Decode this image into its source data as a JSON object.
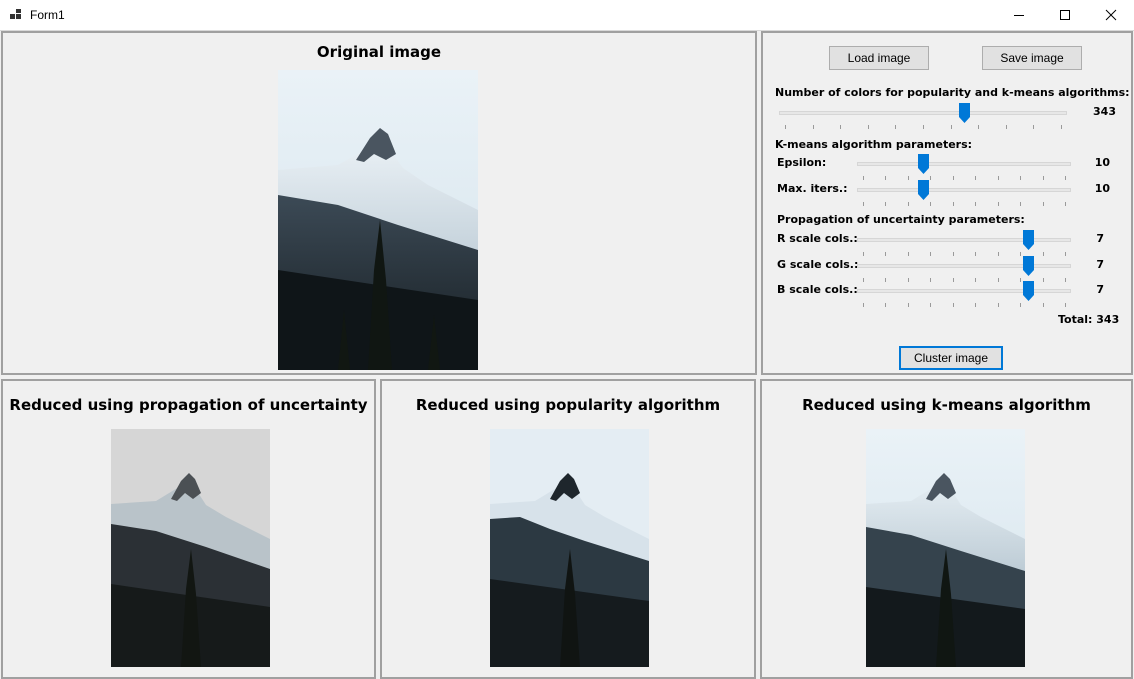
{
  "window": {
    "title": "Form1",
    "icon": "app-form-icon"
  },
  "panels": {
    "original": {
      "title": "Original image"
    },
    "uncertainty": {
      "title": "Reduced using propagation of uncertainty"
    },
    "popularity": {
      "title": "Reduced using popularity algorithm"
    },
    "kmeans": {
      "title": "Reduced using k-means algorithm"
    }
  },
  "controls": {
    "load_label": "Load image",
    "save_label": "Save image",
    "colors_heading": "Number of colors for popularity and k-means algorithms:",
    "colors_value": "343",
    "colors_level": 0.65,
    "kmeans_heading": "K-means algorithm parameters:",
    "epsilon_label": "Epsilon:",
    "epsilon_value": "10",
    "epsilon_level": 0.3,
    "iters_label": "Max. iters.:",
    "iters_value": "10",
    "iters_level": 0.3,
    "uncertainty_heading": "Propagation of uncertainty parameters:",
    "r_label": "R scale cols.:",
    "r_value": "7",
    "r_level": 0.82,
    "g_label": "G scale cols.:",
    "g_value": "7",
    "g_level": 0.82,
    "b_label": "B scale cols.:",
    "b_value": "7",
    "b_level": 0.82,
    "total_label": "Total: 343",
    "cluster_label": "Cluster image"
  }
}
